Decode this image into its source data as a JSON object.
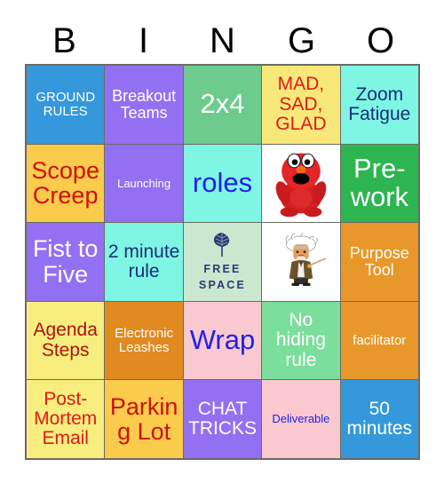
{
  "header": {
    "letters": [
      "B",
      "I",
      "N",
      "G",
      "O"
    ]
  },
  "colors": {
    "blue": "#3498db",
    "purple": "#9370f2",
    "green_medium": "#6dcb8d",
    "yellow_light": "#f8e87a",
    "aqua": "#7ff5e4",
    "gold": "#fbcb4b",
    "green_vivid": "#2cb550",
    "mint": "#c9e8cf",
    "orange": "#e8982a",
    "orange_dark": "#e18a20",
    "pink": "#fac9d0",
    "yellow_pale": "#f7ee7f",
    "white": "#ffffff",
    "text_red": "#cc1111",
    "text_darkred": "#b01010",
    "text_navy": "#1a2f7a",
    "text_blue": "#2020e8",
    "text_white": "#ffffff",
    "grid_line": "#6b6b63"
  },
  "grid": {
    "rows": [
      [
        {
          "text": "GROUND RULES",
          "bg": "#3498db",
          "fg": "#ffffff",
          "size": "s-sm",
          "name": "cell-ground-rules"
        },
        {
          "text": "Breakout Teams",
          "bg": "#9370f2",
          "fg": "#ffffff",
          "size": "s-md",
          "name": "cell-breakout-teams"
        },
        {
          "text": "2x4",
          "bg": "#6dcb8d",
          "fg": "#ffffff",
          "size": "s-xxl",
          "name": "cell-2x4"
        },
        {
          "text": "MAD, SAD, GLAD",
          "bg": "#f8e87a",
          "fg": "#e01a1a",
          "size": "s-lg",
          "name": "cell-mad-sad-glad"
        },
        {
          "text": "Zoom Fatigue",
          "bg": "#7ff5e4",
          "fg": "#1a2f7a",
          "size": "s-lg",
          "name": "cell-zoom-fatigue"
        }
      ],
      [
        {
          "text": "Scope Creep",
          "bg": "#fbcb4b",
          "fg": "#cc1111",
          "size": "s-xl",
          "name": "cell-scope-creep"
        },
        {
          "text": "Launching",
          "bg": "#9370f2",
          "fg": "#ffffff",
          "size": "s-xs",
          "name": "cell-launching"
        },
        {
          "text": "roles",
          "bg": "#7ff5e4",
          "fg": "#2020e8",
          "size": "s-xxl",
          "name": "cell-roles"
        },
        {
          "text": "",
          "bg": "#ffffff",
          "fg": "#000000",
          "size": "s-sm",
          "name": "cell-elmo-image",
          "icon": "elmo-plush-image"
        },
        {
          "text": "Pre-work",
          "bg": "#2cb550",
          "fg": "#ffffff",
          "size": "s-xxl",
          "name": "cell-pre-work"
        }
      ],
      [
        {
          "text": "Fist to Five",
          "bg": "#9370f2",
          "fg": "#ffffff",
          "size": "s-xl",
          "name": "cell-fist-to-five"
        },
        {
          "text": "2 minute rule",
          "bg": "#7ff5e4",
          "fg": "#1a2f7a",
          "size": "s-lg",
          "name": "cell-2-minute-rule"
        },
        {
          "text": "FREE SPACE",
          "bg": "#c9e8cf",
          "fg": "#2d3a73",
          "size": "s-xs",
          "name": "cell-free-space",
          "icon": "leaf-icon"
        },
        {
          "text": "",
          "bg": "#ffffff",
          "fg": "#000000",
          "size": "s-sm",
          "name": "cell-einstein-image",
          "icon": "einstein-cartoon-image"
        },
        {
          "text": "Purpose Tool",
          "bg": "#e8982a",
          "fg": "#ffffff",
          "size": "s-md",
          "name": "cell-purpose-tool"
        }
      ],
      [
        {
          "text": "Agenda Steps",
          "bg": "#f7ee7f",
          "fg": "#b01010",
          "size": "s-lg",
          "name": "cell-agenda-steps"
        },
        {
          "text": "Electronic Leashes",
          "bg": "#e18a20",
          "fg": "#ffffff",
          "size": "s-sm",
          "name": "cell-electronic-leashes"
        },
        {
          "text": "Wrap",
          "bg": "#fac9d0",
          "fg": "#2020e8",
          "size": "s-xxl",
          "name": "cell-wrap"
        },
        {
          "text": "No hiding rule",
          "bg": "#7bde9b",
          "fg": "#ffffff",
          "size": "s-lg",
          "name": "cell-no-hiding-rule"
        },
        {
          "text": "facilitator",
          "bg": "#e8982a",
          "fg": "#ffffff",
          "size": "s-sm",
          "name": "cell-facilitator"
        }
      ],
      [
        {
          "text": "Post-Mortem Email",
          "bg": "#f7ee7f",
          "fg": "#e01a1a",
          "size": "s-lg",
          "name": "cell-post-mortem-email"
        },
        {
          "text": "Parking Lot",
          "bg": "#fbcb4b",
          "fg": "#cc1111",
          "size": "s-xl",
          "name": "cell-parking-lot"
        },
        {
          "text": "CHAT TRICKS",
          "bg": "#9370f2",
          "fg": "#ffffff",
          "size": "s-lg",
          "name": "cell-chat-tricks"
        },
        {
          "text": "Deliverable",
          "bg": "#fac9d0",
          "fg": "#2020e8",
          "size": "s-xs",
          "name": "cell-deliverable"
        },
        {
          "text": "50 minutes",
          "bg": "#3498db",
          "fg": "#ffffff",
          "size": "s-lg",
          "name": "cell-50-minutes"
        }
      ]
    ],
    "free_space": {
      "line1": "FREE",
      "line2": "SPACE"
    }
  }
}
